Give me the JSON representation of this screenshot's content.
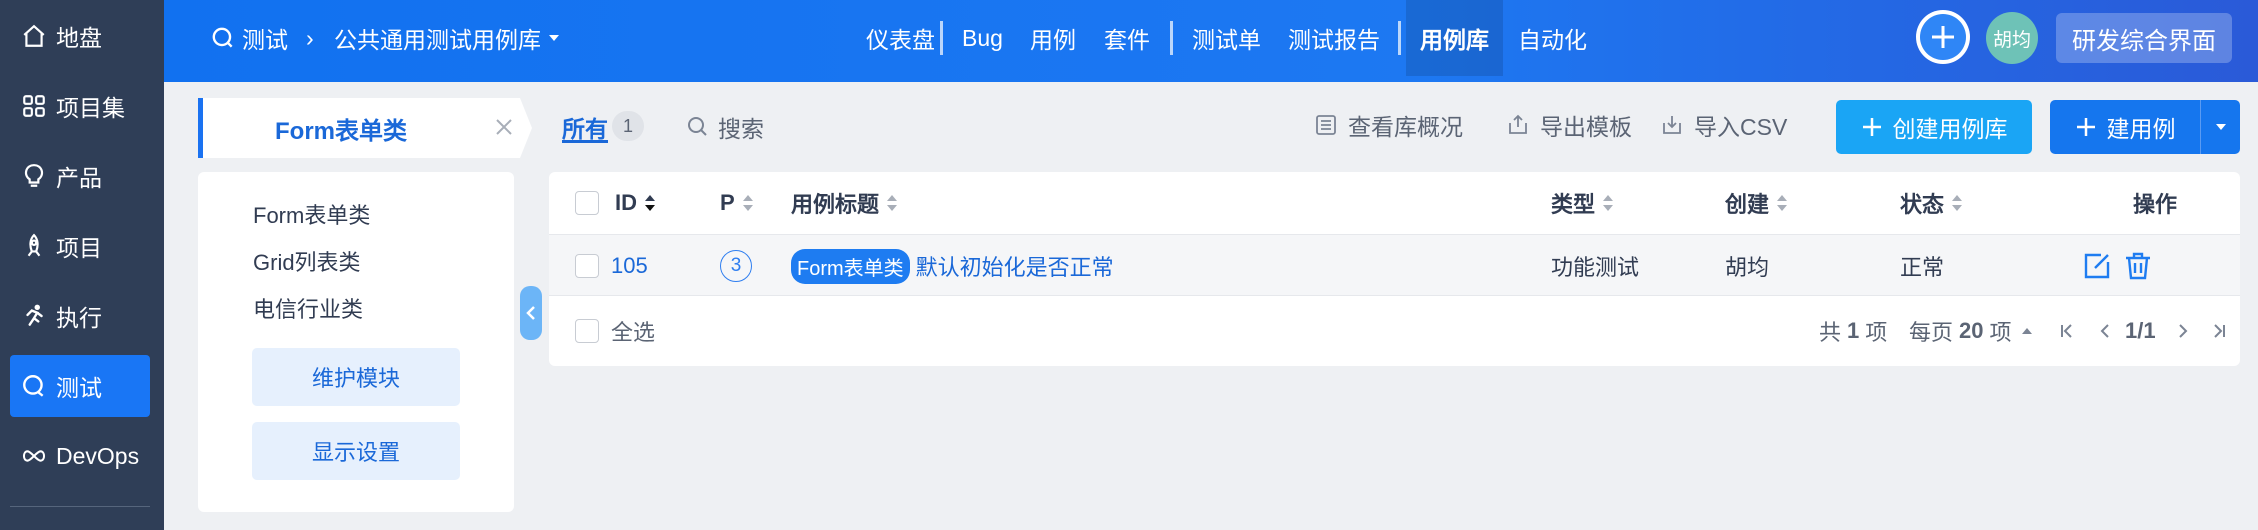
{
  "sidebar": {
    "items": [
      {
        "label": "地盘",
        "icon": "home-icon"
      },
      {
        "label": "项目集",
        "icon": "grid-icon"
      },
      {
        "label": "产品",
        "icon": "bulb-icon"
      },
      {
        "label": "项目",
        "icon": "rocket-icon"
      },
      {
        "label": "执行",
        "icon": "run-icon"
      },
      {
        "label": "测试",
        "icon": "test-icon",
        "active": true
      },
      {
        "label": "DevOps",
        "icon": "infinity-icon"
      }
    ]
  },
  "header": {
    "app": "测试",
    "breadcrumb_sep": "›",
    "library": "公共通用测试用例库",
    "nav": [
      "仪表盘",
      "Bug",
      "用例",
      "套件",
      "测试单",
      "测试报告",
      "用例库",
      "自动化"
    ],
    "active_nav": "用例库",
    "avatar_text": "胡均",
    "ui_button": "研发综合界面"
  },
  "module_tab": {
    "label": "Form表单类"
  },
  "tree": {
    "items": [
      "Form表单类",
      "Grid列表类",
      "电信行业类"
    ],
    "maintain_button": "维护模块",
    "display_button": "显示设置"
  },
  "toolbar": {
    "tab_all": "所有",
    "tab_count": "1",
    "search": "搜索",
    "view_lib": "查看库概况",
    "export_template": "导出模板",
    "import_csv": "导入CSV",
    "create_lib": "创建用例库",
    "create_case": "建用例"
  },
  "table": {
    "columns": {
      "id": "ID",
      "pri": "P",
      "title": "用例标题",
      "type": "类型",
      "creator": "创建",
      "status": "状态",
      "actions": "操作"
    },
    "rows": [
      {
        "id": "105",
        "pri": "3",
        "tag": "Form表单类",
        "title": "默认初始化是否正常",
        "type": "功能测试",
        "creator": "胡均",
        "status": "正常"
      }
    ],
    "select_all": "全选",
    "pager": {
      "total_prefix": "共",
      "total": "1",
      "total_suffix": "项",
      "per_page_prefix": "每页",
      "per_page": "20",
      "per_page_suffix": "项",
      "page": "1/1"
    }
  },
  "colors": {
    "sidebar": "#2f3e57",
    "header": "#1171f0",
    "accent": "#1a68d8",
    "create_lib": "#1aa5f5",
    "create_case": "#1576ee"
  }
}
